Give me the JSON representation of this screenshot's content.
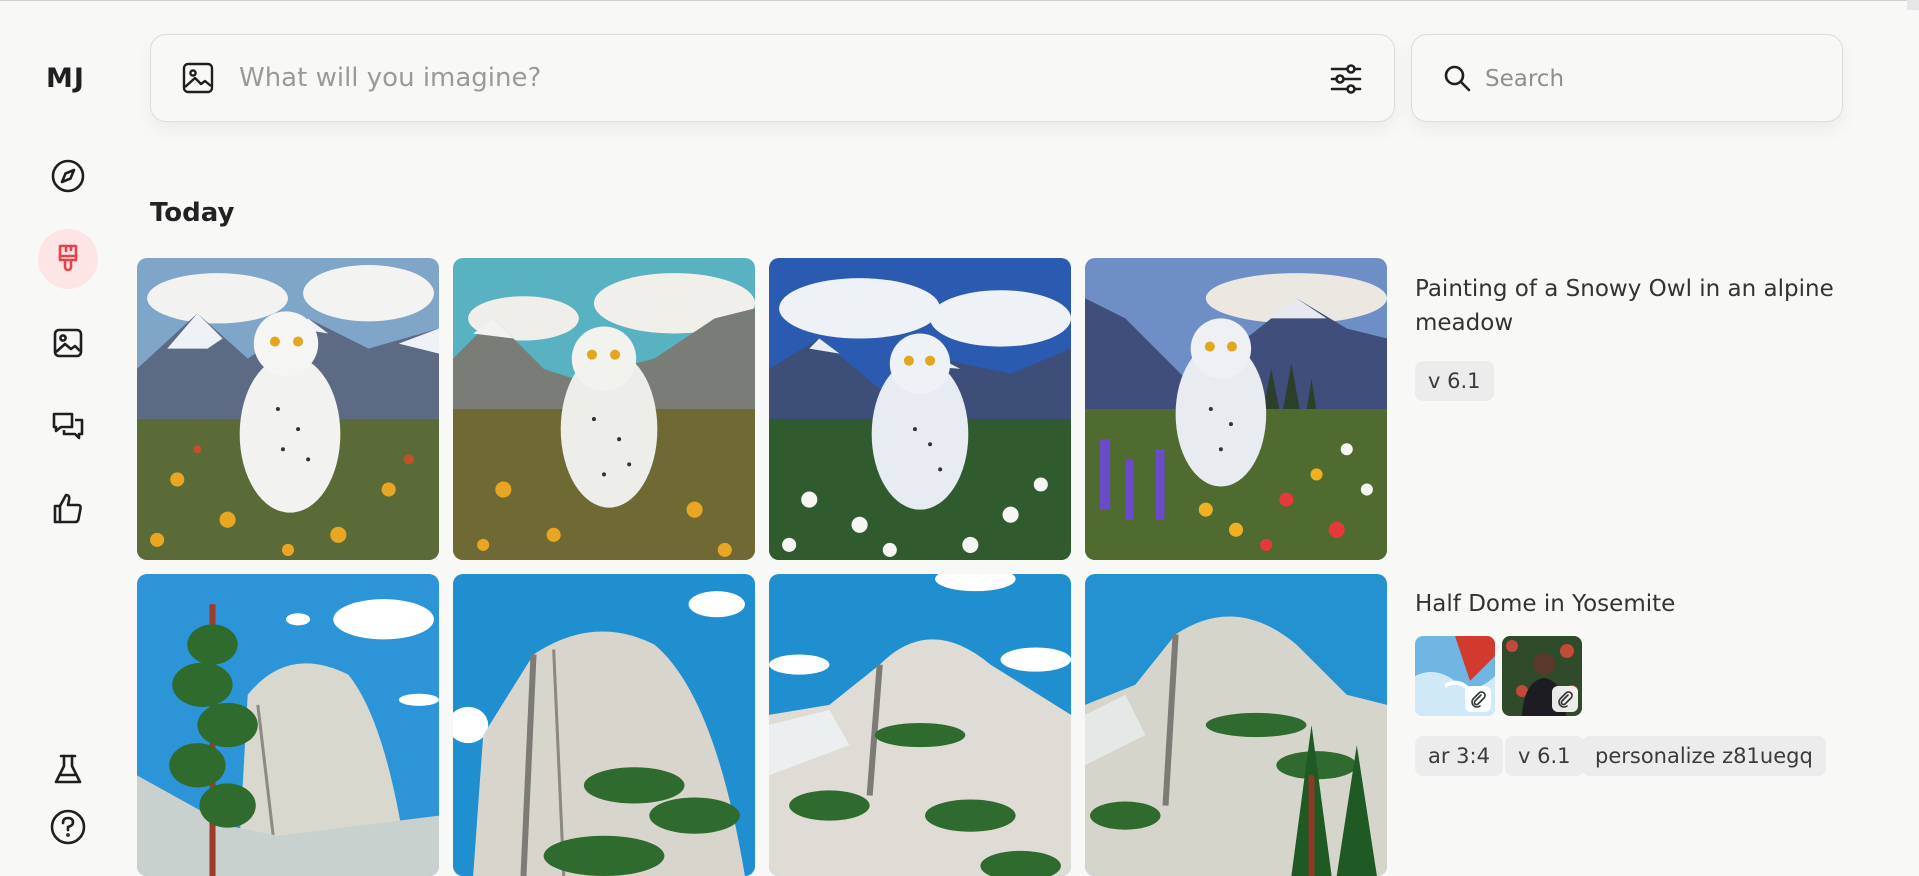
{
  "sidebar": {
    "logo": "MJ",
    "items": [
      {
        "name": "explore",
        "icon": "compass-icon"
      },
      {
        "name": "create",
        "icon": "paintbrush-icon",
        "active": true
      },
      {
        "name": "organize",
        "icon": "image-icon"
      },
      {
        "name": "chat",
        "icon": "chat-bubbles-icon"
      },
      {
        "name": "rank",
        "icon": "thumbs-up-icon"
      },
      {
        "name": "lab",
        "icon": "flask-icon"
      },
      {
        "name": "help",
        "icon": "help-circle-icon"
      }
    ]
  },
  "prompt": {
    "placeholder": "What will you imagine?"
  },
  "search": {
    "placeholder": "Search"
  },
  "colors": {
    "accent": "#e8414a",
    "active_bg": "#fde5e6",
    "background": "#f8f8f7"
  },
  "section": {
    "title": "Today"
  },
  "jobs": [
    {
      "prompt": "Painting of a Snowy Owl in an alpine meadow",
      "tags": [
        "v 6.1"
      ],
      "images": [
        "snowy-owl-1",
        "snowy-owl-2",
        "snowy-owl-3",
        "snowy-owl-4"
      ]
    },
    {
      "prompt": "Half Dome in Yosemite",
      "reference_images": [
        "reference-image-1",
        "reference-image-2"
      ],
      "tags": [
        "ar 3:4",
        "v 6.1",
        "personalize z81uegq"
      ],
      "images": [
        "half-dome-1",
        "half-dome-2",
        "half-dome-3",
        "half-dome-4"
      ]
    }
  ]
}
